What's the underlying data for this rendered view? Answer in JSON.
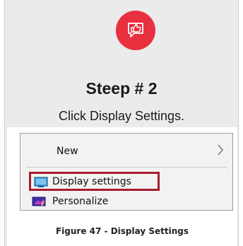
{
  "step": {
    "badge_icon": "thumbs-up-speech-icon",
    "badge_color": "#e8303f",
    "title": "Steep # 2",
    "description": "Click Display Settings."
  },
  "figure": {
    "menu": {
      "items": [
        {
          "label": "New",
          "icon": "chevron-right-icon"
        },
        {
          "label": "Display settings",
          "icon": "monitor-icon",
          "highlighted": true,
          "highlight_color": "#a61c2f"
        },
        {
          "label": "Personalize",
          "icon": "personalize-icon"
        }
      ]
    },
    "caption": "Figure 47 - Display Settings"
  }
}
